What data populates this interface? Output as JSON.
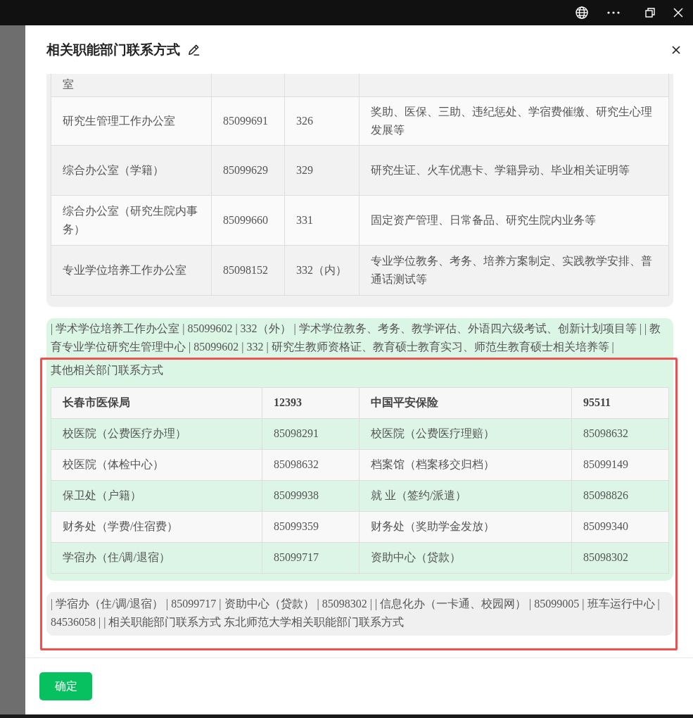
{
  "dialog": {
    "title": "相关职能部门联系方式",
    "confirm_button": "确定"
  },
  "dept_table": {
    "rows": [
      {
        "name": "室"
      },
      {
        "name": "研究生管理工作办公室",
        "phone": "85099691",
        "ext": "326",
        "duties": "奖助、医保、三助、违纪惩处、学宿费催缴、研究生心理发展等"
      },
      {
        "name": "综合办公室（学籍）",
        "phone": "85099629",
        "ext": "329",
        "duties": "研究生证、火车优惠卡、学籍异动、毕业相关证明等"
      },
      {
        "name": "综合办公室（研究生院内事务）",
        "phone": "85099660",
        "ext": "331",
        "duties": "固定资产管理、日常备品、研究生院内业务等"
      },
      {
        "name": "专业学位培养工作办公室",
        "phone": "85098152",
        "ext": "332（内）",
        "duties": "专业学位教务、考务、培养方案制定、实践教学安排、普通话测试等"
      }
    ]
  },
  "note_paragraph": "| 学术学位培养工作办公室 | 85099602 | 332（外） | 学术学位教务、考务、教学评估、外语四六级考试、创新计划项目等 | | 教育专业学位研究生管理中心 | 85099602 | 332 | 研究生教师资格证、教育硕士教育实习、师范生教育硕士相关培养等 |",
  "other_section": {
    "heading": "其他相关部门联系方式",
    "rows": [
      [
        "长春市医保局",
        "12393",
        "中国平安保险",
        "95511"
      ],
      [
        "校医院（公费医疗办理）",
        "85098291",
        "校医院（公费医疗理赔）",
        "85098632"
      ],
      [
        "校医院（体检中心）",
        "85098632",
        "档案馆（档案移交归档）",
        "85099149"
      ],
      [
        "保卫处（户籍）",
        "85099938",
        "就 业（签约/派遣）",
        "85098826"
      ],
      [
        "财务处（学费/住宿费）",
        "85099359",
        "财务处（奖助学金发放）",
        "85099340"
      ],
      [
        "学宿办（住/调/退宿）",
        "85099717",
        "资助中心（贷款）",
        "85098302"
      ]
    ]
  },
  "footer_paragraph": "| 学宿办（住/调/退宿） | 85099717 | 资助中心（贷款） | 85098302 | | 信息化办（一卡通、校园网） | 85099005 | 班车运行中心 | 84536058 | | 相关职能部门联系方式 东北师范大学相关职能部门联系方式"
}
